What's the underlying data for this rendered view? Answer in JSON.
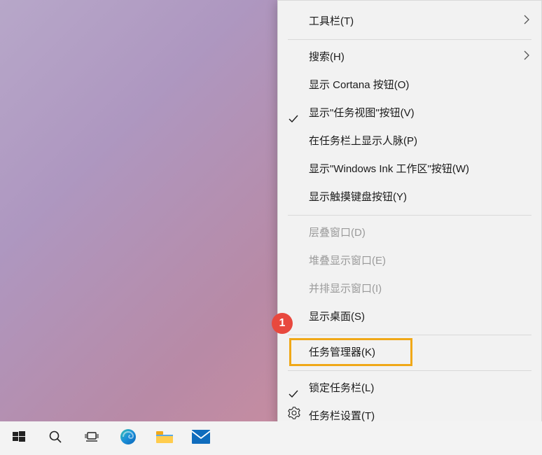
{
  "menu": {
    "toolbar": "工具栏(T)",
    "search": "搜索(H)",
    "show_cortana": "显示 Cortana 按钮(O)",
    "show_taskview": "显示\"任务视图\"按钮(V)",
    "show_people": "在任务栏上显示人脉(P)",
    "show_ink": "显示\"Windows Ink 工作区\"按钮(W)",
    "show_touchkb": "显示触摸键盘按钮(Y)",
    "cascade": "层叠窗口(D)",
    "stacked": "堆叠显示窗口(E)",
    "sidebyside": "并排显示窗口(I)",
    "show_desktop": "显示桌面(S)",
    "task_manager": "任务管理器(K)",
    "lock_taskbar": "锁定任务栏(L)",
    "taskbar_settings": "任务栏设置(T)"
  },
  "annotation": {
    "number": "1"
  }
}
